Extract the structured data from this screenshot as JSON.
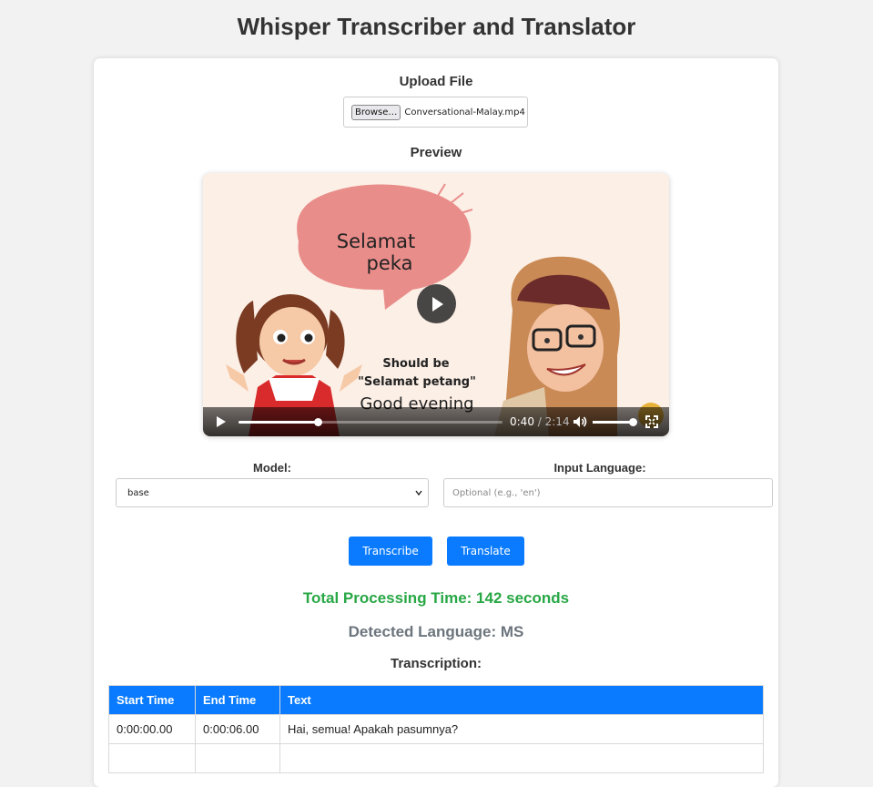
{
  "app": {
    "title": "Whisper Transcriber and Translator"
  },
  "upload": {
    "heading": "Upload File",
    "browse_label": "Browse…",
    "file_name": "Conversational-Malay.mp4"
  },
  "preview": {
    "heading": "Preview",
    "video": {
      "current_time": "0:40",
      "separator": " / ",
      "duration": "2:14",
      "progress_fraction": 0.3,
      "volume_fraction": 1.0,
      "scene_text": {
        "bubble": [
          "Selamat",
          "peka"
        ],
        "caption": [
          "Should be",
          "\"Selamat petang\"",
          "Good evening"
        ]
      }
    }
  },
  "form": {
    "model_label": "Model:",
    "model_value": "base",
    "language_label": "Input Language:",
    "language_placeholder": "Optional (e.g., 'en')",
    "language_value": "",
    "transcribe_label": "Transcribe",
    "translate_label": "Translate"
  },
  "results": {
    "processing_time": "Total Processing Time: 142 seconds",
    "detected_language": "Detected Language: MS",
    "transcription_heading": "Transcription:",
    "columns": [
      "Start Time",
      "End Time",
      "Text"
    ],
    "rows": [
      [
        "0:00:00.00",
        "0:00:06.00",
        "Hai, semua! Apakah pasumnya?"
      ]
    ]
  },
  "colors": {
    "accent": "#0a7bff",
    "processing_text": "#28a745",
    "detected_text": "#6c757d"
  }
}
